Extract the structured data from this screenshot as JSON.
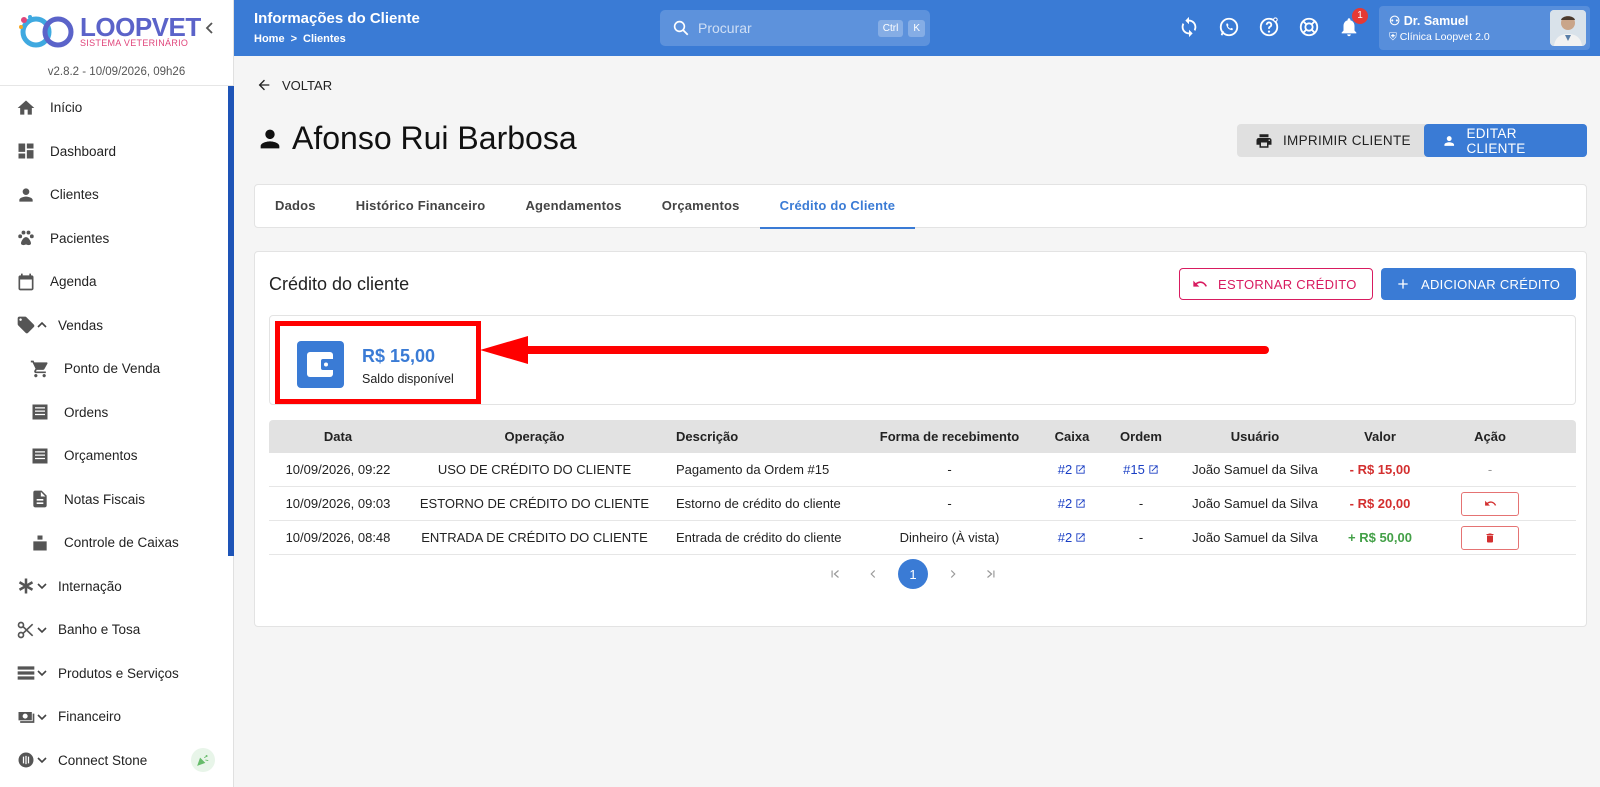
{
  "app": {
    "logo_text": "LOOPVET",
    "logo_sub": "SISTEMA VETERINÁRIO",
    "version": "v2.8.2 - 10/09/2026, 09h26"
  },
  "sidebar": {
    "items": [
      {
        "label": "Início",
        "icon": "home-icon"
      },
      {
        "label": "Dashboard",
        "icon": "dashboard-icon"
      },
      {
        "label": "Clientes",
        "icon": "person-icon"
      },
      {
        "label": "Pacientes",
        "icon": "paw-icon"
      },
      {
        "label": "Agenda",
        "icon": "calendar-icon"
      },
      {
        "label": "Vendas",
        "icon": "tag-icon"
      },
      {
        "label": "Ponto de Venda",
        "icon": "cart-icon"
      },
      {
        "label": "Ordens",
        "icon": "list-icon"
      },
      {
        "label": "Orçamentos",
        "icon": "list-icon"
      },
      {
        "label": "Notas Fiscais",
        "icon": "document-icon"
      },
      {
        "label": "Controle de Caixas",
        "icon": "cash-register-icon"
      },
      {
        "label": "Internação",
        "icon": "asterisk-icon"
      },
      {
        "label": "Banho e Tosa",
        "icon": "scissors-icon"
      },
      {
        "label": "Produtos e Serviços",
        "icon": "storage-icon"
      },
      {
        "label": "Financeiro",
        "icon": "money-icon"
      },
      {
        "label": "Connect Stone",
        "icon": "nfc-icon"
      }
    ]
  },
  "topbar": {
    "title": "Informações do Cliente",
    "crumb_home": "Home",
    "crumb_sep": ">",
    "crumb_current": "Clientes",
    "search_placeholder": "Procurar",
    "kbd_ctrl": "Ctrl",
    "kbd_k": "K",
    "notif_count": "1",
    "user_name": "Dr. Samuel",
    "user_clinic": "Clínica Loopvet 2.0"
  },
  "page": {
    "back_label": "VOLTAR",
    "client_name": "Afonso Rui Barbosa",
    "print_label": "IMPRIMIR CLIENTE",
    "edit_label": "EDITAR CLIENTE"
  },
  "tabs": [
    "Dados",
    "Histórico Financeiro",
    "Agendamentos",
    "Orçamentos",
    "Crédito do Cliente"
  ],
  "credit": {
    "title": "Crédito do cliente",
    "estornar_label": "ESTORNAR CRÉDITO",
    "add_label": "ADICIONAR CRÉDITO",
    "balance": "R$ 15,00",
    "balance_label": "Saldo disponível"
  },
  "table": {
    "headers": [
      "Data",
      "Operação",
      "Descrição",
      "Forma de recebimento",
      "Caixa",
      "Ordem",
      "Usuário",
      "Valor",
      "Ação"
    ],
    "rows": [
      {
        "data": "10/09/2026, 09:22",
        "operacao": "USO DE CRÉDITO DO CLIENTE",
        "descricao": "Pagamento da Ordem #15",
        "forma": "-",
        "caixa": "#2",
        "ordem": "#15",
        "usuario": "João Samuel da Silva",
        "valor": "- R$ 15,00",
        "acao": "-"
      },
      {
        "data": "10/09/2026, 09:03",
        "operacao": "ESTORNO DE CRÉDITO DO CLIENTE",
        "descricao": "Estorno de crédito do cliente",
        "forma": "-",
        "caixa": "#2",
        "ordem": "-",
        "usuario": "João Samuel da Silva",
        "valor": "- R$ 20,00",
        "acao": "undo"
      },
      {
        "data": "10/09/2026, 08:48",
        "operacao": "ENTRADA DE CRÉDITO DO CLIENTE",
        "descricao": "Entrada de crédito do cliente",
        "forma": "Dinheiro (À vista)",
        "caixa": "#2",
        "ordem": "-",
        "usuario": "João Samuel da Silva",
        "valor": "+ R$ 50,00",
        "acao": "delete"
      }
    ]
  },
  "pagination": {
    "current": "1"
  },
  "colors": {
    "primary": "#3a7bd5",
    "danger": "#d32f2f",
    "success": "#43a047",
    "highlight": "#ff0000"
  }
}
